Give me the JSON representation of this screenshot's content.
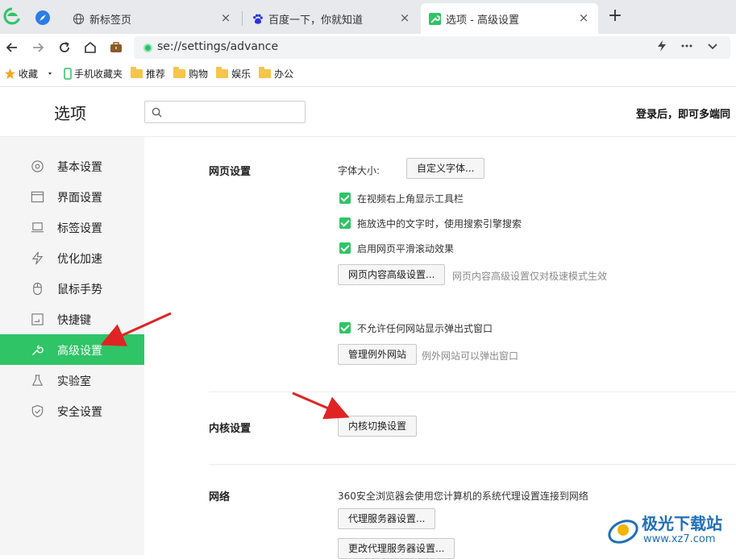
{
  "browser": {
    "tabs": [
      {
        "title": "新标签页",
        "icon": "globe-icon",
        "active": false
      },
      {
        "title": "百度一下，你就知道",
        "icon": "baidu-paw-icon",
        "active": false
      },
      {
        "title": "选项 - 高级设置",
        "icon": "wrench-icon",
        "active": true
      }
    ],
    "new_tab": "+",
    "close_glyph": "×",
    "address": "se://settings/advance",
    "accent": "#2fc466"
  },
  "bookmarks": {
    "items": [
      {
        "label": "收藏",
        "icon": "star-icon"
      },
      {
        "label": "手机收藏夹",
        "icon": "phone-icon"
      },
      {
        "label": "推荐",
        "icon": "folder-icon"
      },
      {
        "label": "购物",
        "icon": "folder-icon"
      },
      {
        "label": "娱乐",
        "icon": "folder-icon"
      },
      {
        "label": "办公",
        "icon": "folder-icon"
      }
    ]
  },
  "header": {
    "title": "选项",
    "search_placeholder": "",
    "login_tip": "登录后，即可多端同"
  },
  "sidebar": {
    "items": [
      {
        "label": "基本设置",
        "icon": "gear-icon",
        "active": false
      },
      {
        "label": "界面设置",
        "icon": "window-icon",
        "active": false
      },
      {
        "label": "标签设置",
        "icon": "laptop-icon",
        "active": false
      },
      {
        "label": "优化加速",
        "icon": "lightning-icon",
        "active": false
      },
      {
        "label": "鼠标手势",
        "icon": "mouse-icon",
        "active": false
      },
      {
        "label": "快捷键",
        "icon": "keyboard-icon",
        "active": false
      },
      {
        "label": "高级设置",
        "icon": "wrench-icon",
        "active": true
      },
      {
        "label": "实验室",
        "icon": "flask-icon",
        "active": false
      },
      {
        "label": "安全设置",
        "icon": "shield-icon",
        "active": false
      }
    ]
  },
  "content": {
    "webpage": {
      "title": "网页设置",
      "font_size_label": "字体大小:",
      "custom_font_button": "自定义字体...",
      "checkboxes": [
        {
          "label": "在视频右上角显示工具栏",
          "checked": true
        },
        {
          "label": "拖放选中的文字时，使用搜索引擎搜索",
          "checked": true
        },
        {
          "label": "启用网页平滑滚动效果",
          "checked": true
        }
      ],
      "advanced_content_button": "网页内容高级设置...",
      "advanced_content_hint": "网页内容高级设置仅对极速模式生效",
      "popup_checkbox": {
        "label": "不允许任何网站显示弹出式窗口",
        "checked": true
      },
      "manage_exceptions_button": "管理例外网站",
      "manage_exceptions_hint": "例外网站可以弹出窗口"
    },
    "kernel": {
      "title": "内核设置",
      "switch_button": "内核切换设置"
    },
    "network": {
      "title": "网络",
      "description": "360安全浏览器会使用您计算机的系统代理设置连接到网络",
      "proxy_button": "代理服务器设置...",
      "change_proxy_button": "更改代理服务器设置..."
    }
  },
  "watermark": {
    "text": "极光下载站",
    "url": "www.xz7.com"
  }
}
